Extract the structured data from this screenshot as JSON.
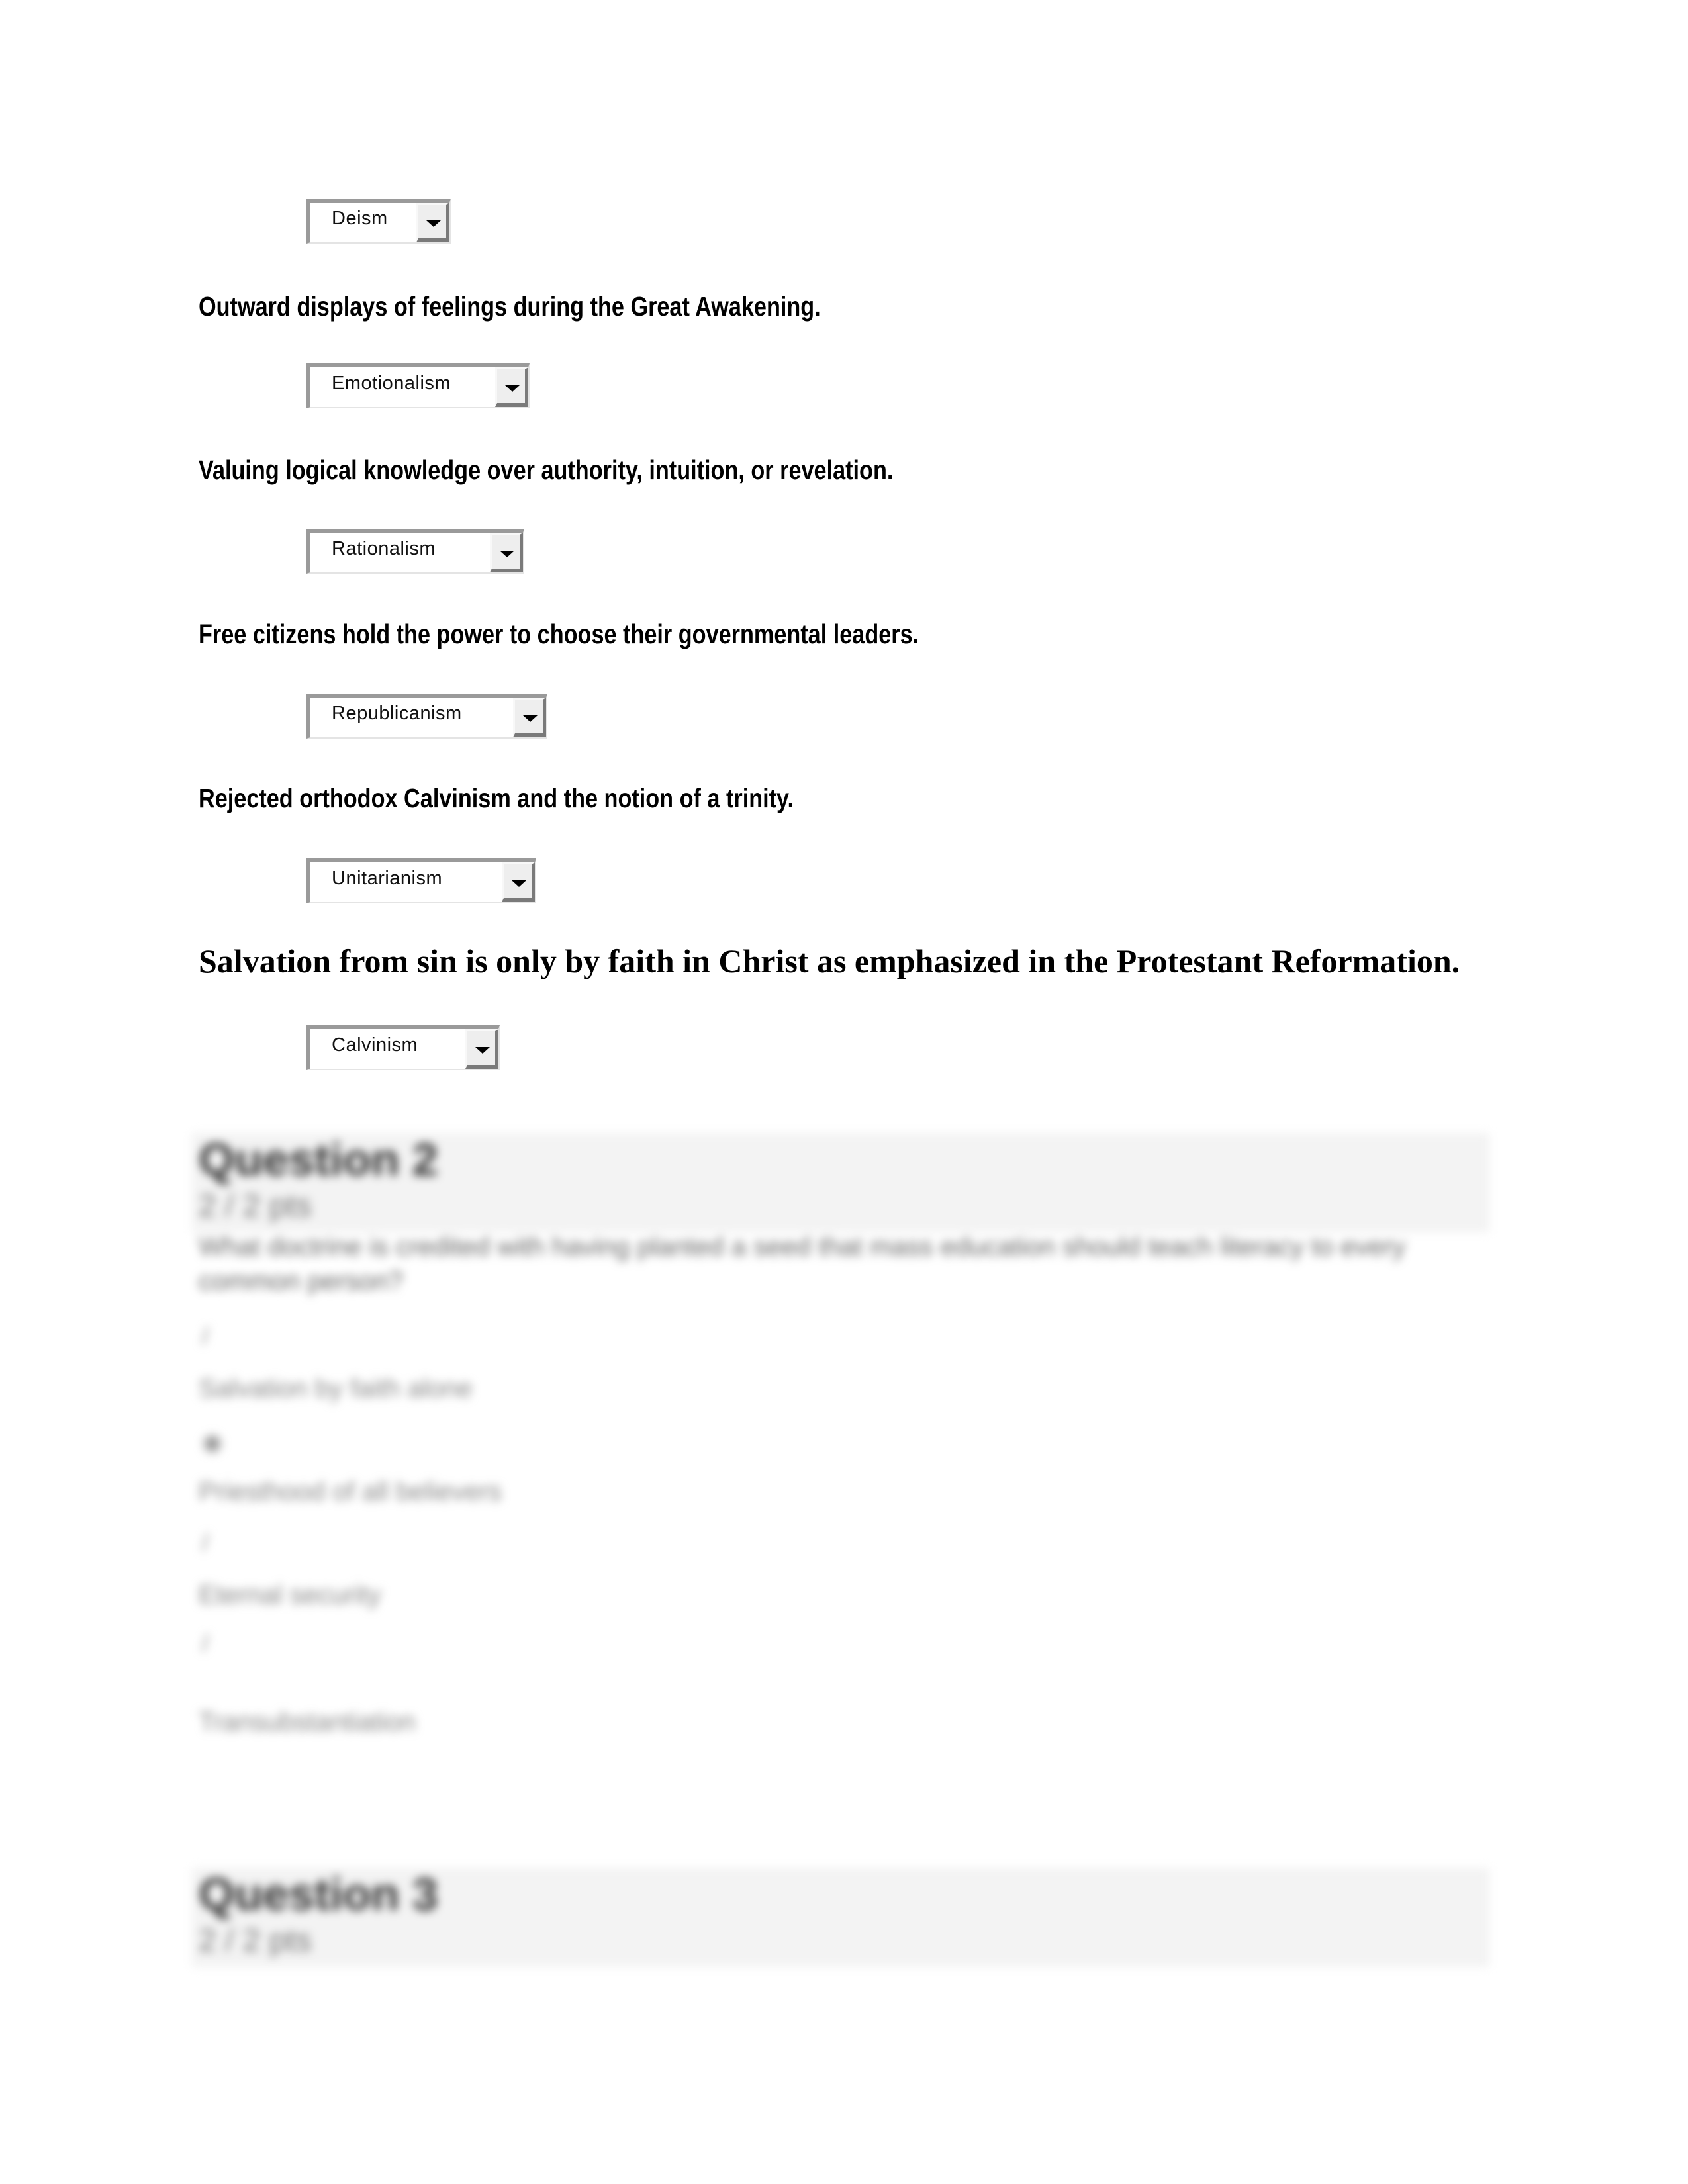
{
  "matching": [
    {
      "prompt": null,
      "selected": "Deism"
    },
    {
      "prompt": "Outward displays of feelings during the Great Awakening.",
      "selected": "Emotionalism"
    },
    {
      "prompt": "Valuing logical knowledge over authority, intuition, or revelation.",
      "selected": "Rationalism"
    },
    {
      "prompt": "Free citizens hold the power to choose their governmental leaders.",
      "selected": "Republicanism"
    },
    {
      "prompt": "Rejected orthodox Calvinism and the notion of a trinity.",
      "selected": "Unitarianism"
    },
    {
      "prompt": "Salvation from sin is only by faith in Christ as emphasized in the Protestant Reformation.",
      "selected": "Calvinism"
    }
  ],
  "question2": {
    "title": "Question 2",
    "points": "2 / 2 pts",
    "text": "What doctrine is credited with having planted a seed that mass education should teach literacy to every common person?",
    "options": [
      {
        "marker": "/",
        "label": "Salvation by faith alone"
      },
      {
        "marker": "◉",
        "label": "Priesthood of all believers"
      },
      {
        "marker": "/",
        "label": "Eternal security"
      },
      {
        "marker": "/",
        "label": "Transubstantiation"
      }
    ]
  },
  "question3": {
    "title": "Question 3",
    "points": "2 / 2 pts"
  }
}
